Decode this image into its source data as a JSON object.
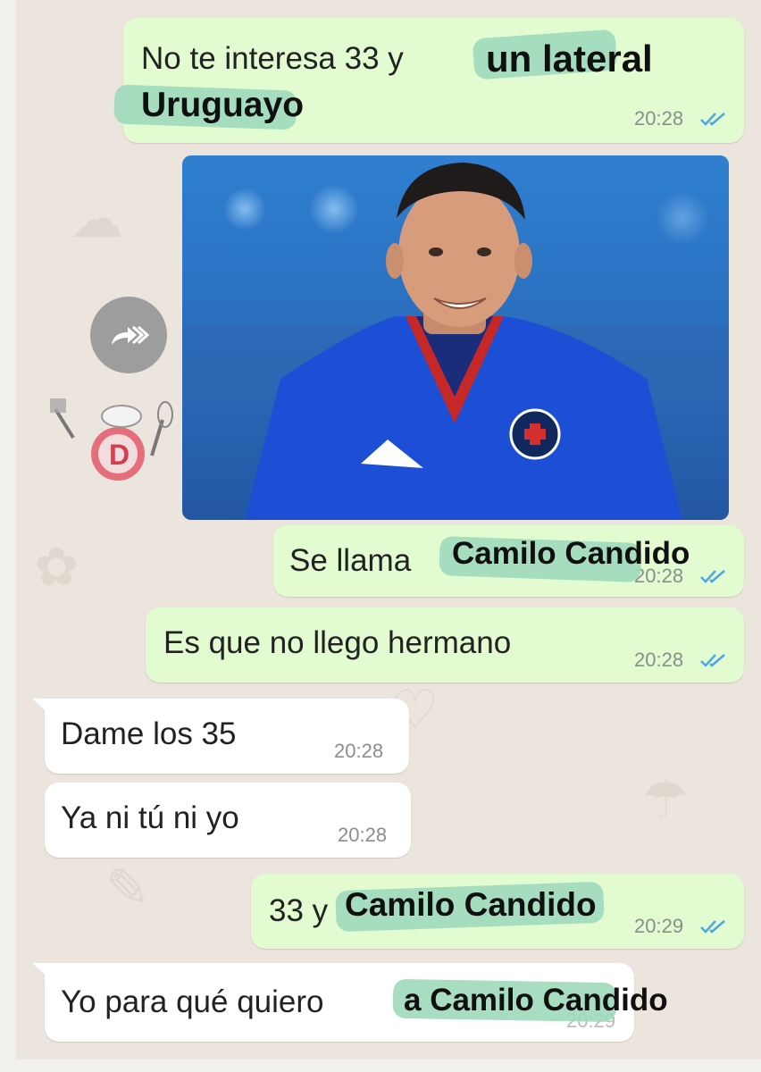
{
  "messages": [
    {
      "text": "No te interesa 33 y",
      "time": "20:28",
      "overlay": "un lateral",
      "overlay2": "Uruguayo"
    },
    {
      "time": "20:28",
      "overlay": "Camilo Candido",
      "text": "Se llama"
    },
    {
      "text": "Es que no llego hermano",
      "time": "20:28"
    },
    {
      "text": "Dame los 35",
      "time": "20:28"
    },
    {
      "text": "Ya ni tú ni yo",
      "time": "20:28"
    },
    {
      "text": "33 y",
      "time": "20:29",
      "overlay": "Camilo Candido"
    },
    {
      "text": "Yo para qué quiero",
      "time": "20:29",
      "overlay": "a Camilo Candido"
    }
  ],
  "icons": {
    "forward": "forward-icon",
    "read_ticks": "double-check-icon",
    "sticker": "chef-sticker-icon"
  },
  "colors": {
    "outgoing_bubble": "#e2fbd0",
    "incoming_bubble": "#ffffff",
    "highlight": "#9fd9bb",
    "read_ticks": "#4fa6e6",
    "chat_background": "#ece5dd"
  }
}
